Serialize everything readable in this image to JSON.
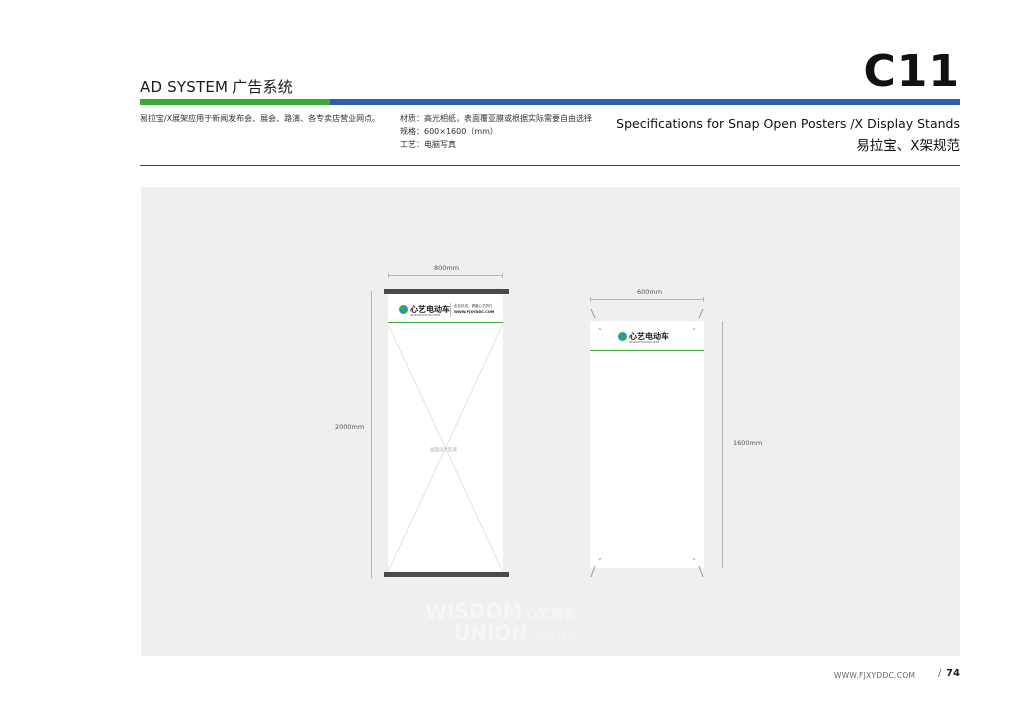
{
  "header": {
    "title_en": "AD SYSTEM",
    "title_cn": "广告系统",
    "page_code": "C11",
    "intro": "易拉宝/X展架应用于新闻发布会、展会、路演、各专卖店营业网点。",
    "specs": [
      "材质：高光相纸，表面覆亚膜或根据实际需要自由选择",
      "规格：600×1600（mm）",
      "工艺：电脑写真"
    ],
    "spec_title_en": "Specifications for  Snap Open Posters /X Display Stands",
    "spec_title_cn": "易拉宝、X架规范"
  },
  "rollup": {
    "width_label": "800mm",
    "height_label": "2000mm",
    "logo_text": "心艺电动车",
    "logo_sub": "WISDOM ELECTRIC BIKE",
    "slogan": "走在科技，健康心艺同行",
    "url": "WWW.FJXYDDC.COM",
    "placeholder": "画面设计区域"
  },
  "xstand": {
    "width_label": "600mm",
    "height_label": "1600mm",
    "logo_text": "心艺电动车",
    "logo_sub": "WISDOM ELECTRIC BIKE"
  },
  "watermark": {
    "line1": "WISDOM",
    "line1_cn": "心艺睿智",
    "line2": "UNION",
    "line2_cn": "品牌设计"
  },
  "footer": {
    "url": "WWW.FJXYDDC.COM",
    "slash": "/",
    "page": "74"
  },
  "colors": {
    "green": "#3aa935",
    "blue": "#2d5faa",
    "canvas": "#eeefee",
    "rail": "#4a4a4a"
  }
}
